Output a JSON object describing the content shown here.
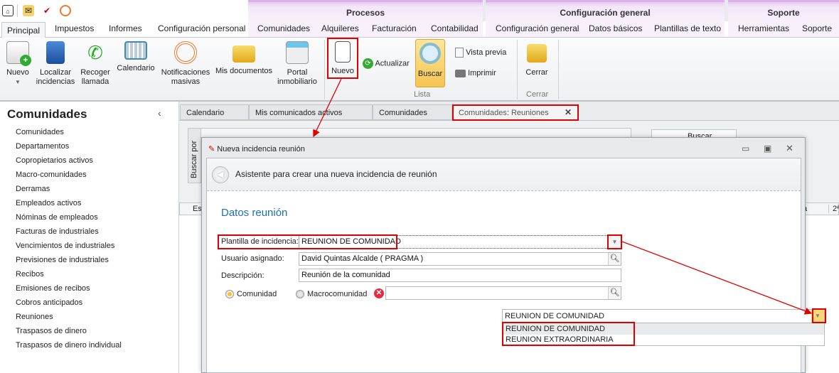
{
  "quick_access": {
    "icons": [
      "app-menu-icon",
      "mail-icon",
      "task-icon",
      "broadcast-icon"
    ]
  },
  "context_groups": [
    {
      "label": "Procesos"
    },
    {
      "label": "Configuración general"
    },
    {
      "label": "Soporte"
    }
  ],
  "tabs": [
    "Principal",
    "Impuestos",
    "Informes",
    "Configuración personal",
    "Comunidades",
    "Alquileres",
    "Facturación",
    "Contabilidad",
    "Configuración general",
    "Datos básicos",
    "Plantillas de texto",
    "Herramientas",
    "Soporte"
  ],
  "ribbon": {
    "nuevo": "Nuevo",
    "localizar": "Localizar incidencias",
    "recoger": "Recoger llamada",
    "calendario": "Calendario",
    "notificaciones": "Notificaciones masivas",
    "documentos": "Mis documentos",
    "portal": "Portal inmobiliario",
    "nuevo2": "Nuevo",
    "actualizar": "Actualizar",
    "buscar": "Buscar",
    "vista_previa": "Vista previa",
    "imprimir": "Imprimir",
    "cerrar": "Cerrar",
    "group_lista": "Lista",
    "group_cerrar": "Cerrar"
  },
  "left": {
    "title": "Comunidades",
    "items": [
      "Comunidades",
      "Departamentos",
      "Copropietarios activos",
      "Macro-comunidades",
      "Derramas",
      "Empleados activos",
      "Nóminas de empleados",
      "Facturas de industriales",
      "Vencimientos de industriales",
      "Previsiones de industriales",
      "Recibos",
      "Emisiones de recibos",
      "Cobros anticipados",
      "Reuniones",
      "Traspasos de dinero",
      "Traspasos de dinero individual"
    ]
  },
  "doc_tabs": [
    "Calendario",
    "Mis comunicados activos",
    "Comunidades",
    "Comunidades: Reuniones"
  ],
  "background": {
    "buscar_por": "Buscar por",
    "buscar_btn": "Buscar",
    "col1": "Es",
    "col2": "a",
    "col3": "2ª"
  },
  "dialog": {
    "title": "Nueva incidencia reunión",
    "wizard_title": "Asistente para crear una nueva incidencia de reunión",
    "section": "Datos reunión",
    "plantilla_label": "Plantilla de incidencia:",
    "plantilla_value": "REUNION DE COMUNIDAD",
    "usuario_label": "Usuario asignado:",
    "usuario_value": "David Quintas Alcalde ( PRAGMA )",
    "descripcion_label": "Descripción:",
    "descripcion_value": "Reunión de la comunidad",
    "radio_comunidad": "Comunidad",
    "radio_macro": "Macrocomunidad",
    "selected_radio": "Comunidad",
    "dropdown_value": "REUNION DE COMUNIDAD",
    "dropdown_options": [
      "REUNION DE COMUNIDAD",
      "REUNION EXTRAORDINARIA"
    ]
  },
  "colors": {
    "highlight": "#e00000",
    "accent": "#1e6fb5"
  }
}
